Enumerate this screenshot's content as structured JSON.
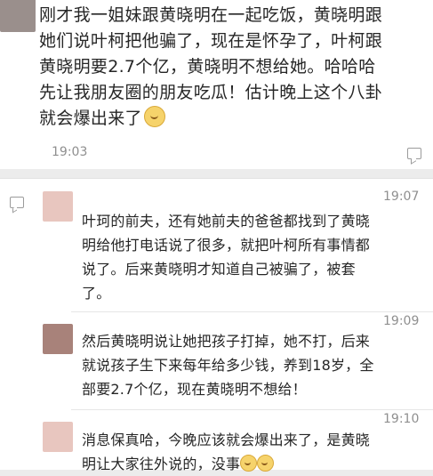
{
  "post": {
    "text": "刚才我一姐妹跟黄晓明在一起吃饭，黄晓明跟\n她们说叶柯把他骗了，现在是怀孕了，叶柯跟\n黄晓明要2.7个亿，黄晓明不想给她。哈哈哈\n先让我朋友圈的朋友吃瓜！估计晚上这个八卦\n就会爆出来了",
    "emoji": "smile-emoji",
    "time": "19:03",
    "comment_icon": "comment-icon"
  },
  "comments": [
    {
      "time": "19:07",
      "text": "叶珂的前夫，还有她前夫的爸爸都找到了黄晓\n明给他打电话说了很多，就把叶柯所有事情都\n说了。后来黄晓明才知道自己被骗了，被套\n了。"
    },
    {
      "time": "19:09",
      "text": "然后黄晓明说让她把孩子打掉，她不打，后来\n就说孩子生下来每年给多少钱，养到18岁，全\n部要2.7个亿，现在黄晓明不想给！"
    },
    {
      "time": "19:10",
      "text": "消息保真哈，今晚应该就会爆出来了，是黄晓\n明让大家往外说的，没事"
    }
  ],
  "colors": {
    "background": "#ececec",
    "card": "#ffffff",
    "text": "#262626",
    "timestamp": "#8f8f8f",
    "avatar": "#e8c6bf"
  }
}
